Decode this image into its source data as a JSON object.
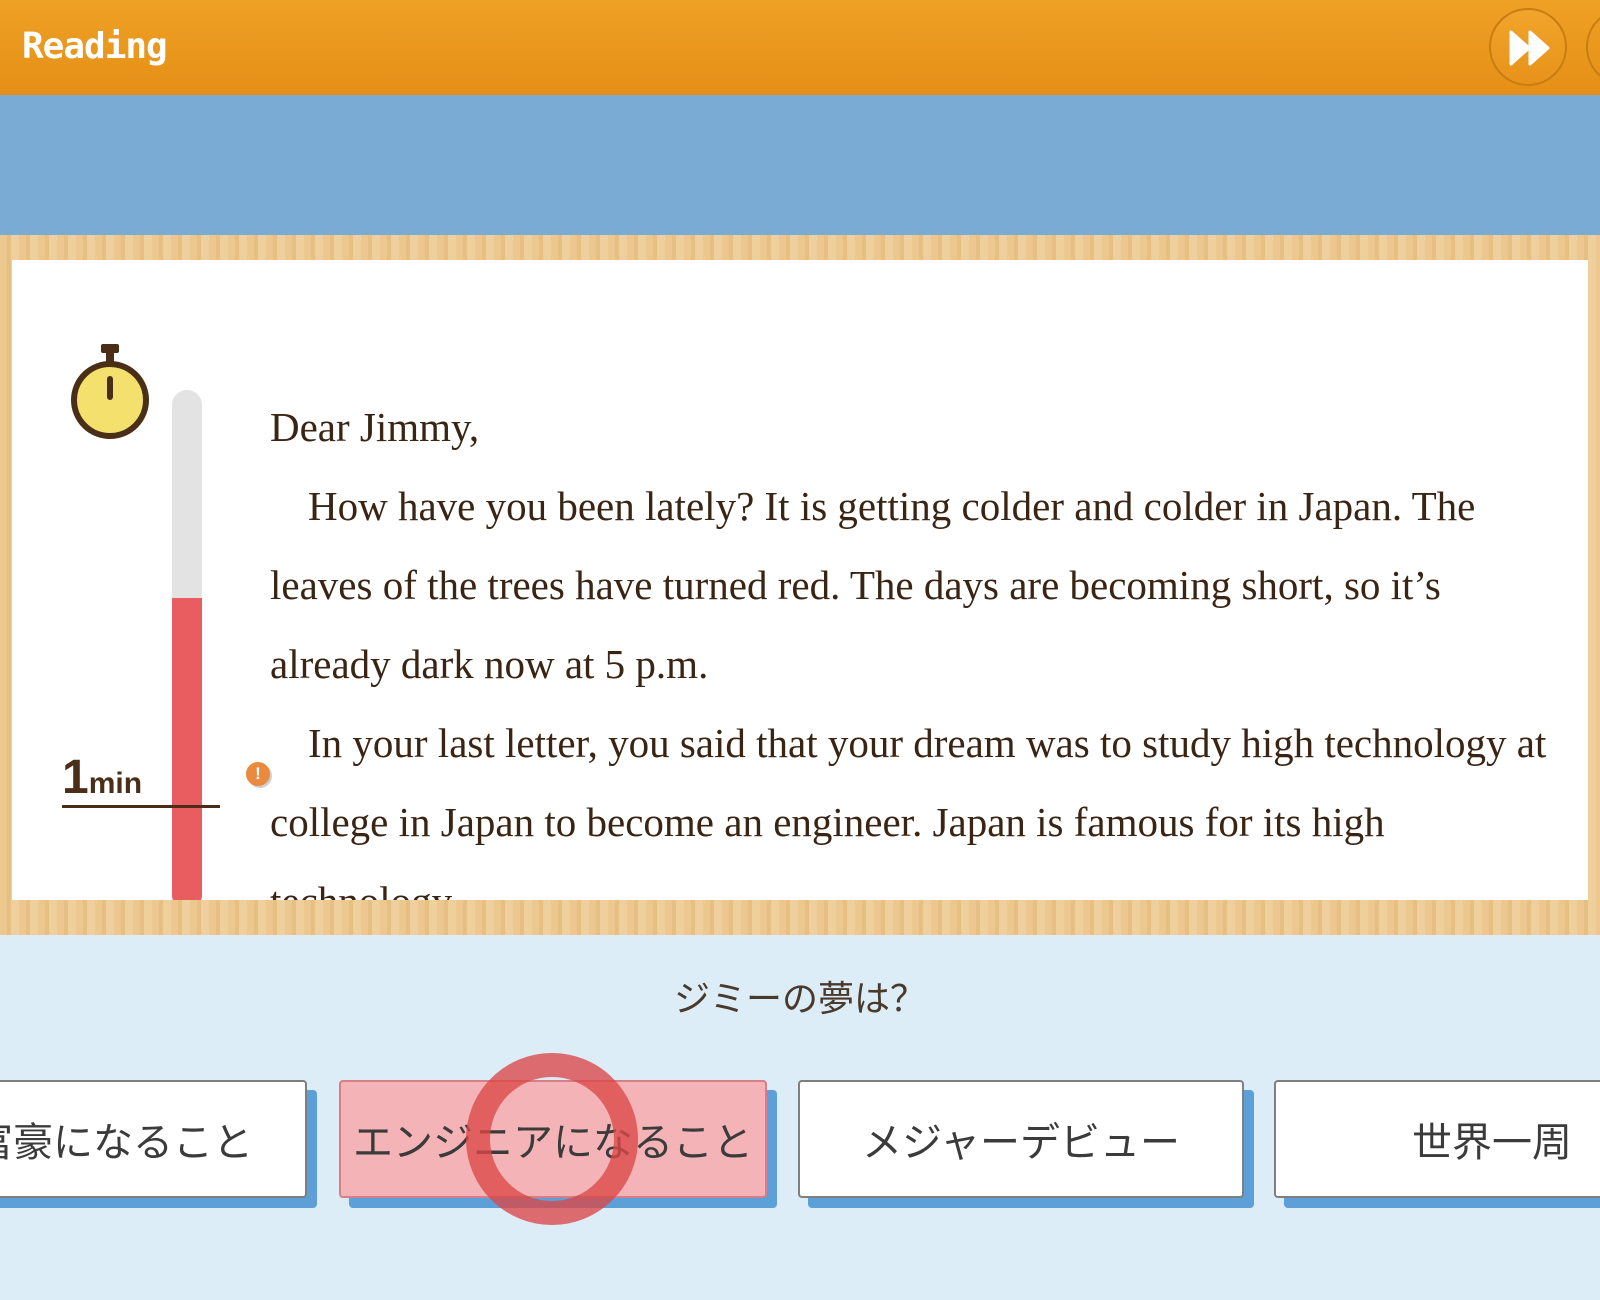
{
  "header": {
    "title": "Reading"
  },
  "timer": {
    "marker_number": "1",
    "marker_unit": "min",
    "progress_fraction": 0.6,
    "warning_symbol": "!"
  },
  "letter": {
    "paragraphs": [
      "Dear Jimmy,",
      "How have you been lately?  It is getting colder and colder in Japan.  The leaves of the trees have turned red.  The days are becoming short, so it’s already dark now at 5 p.m.",
      "In your last letter, you said that your dream was to study high technology at college in Japan to become an engineer.  Japan is famous for its high technology."
    ]
  },
  "question": {
    "text": "ジミーの夢は？"
  },
  "choices": [
    {
      "label": "富豪になること"
    },
    {
      "label": "エンジニアになること"
    },
    {
      "label": "メジャーデビュー"
    },
    {
      "label": "世界一周"
    }
  ],
  "colors": {
    "header": "#e8951b",
    "band": "#7aabd5",
    "timer_fill": "#e95c5f",
    "selected_choice": "#f4b4b7",
    "choice_shadow": "#5d9fd8"
  },
  "icons": {
    "header_button": "fast-forward-icon",
    "timer": "stopwatch-icon"
  }
}
